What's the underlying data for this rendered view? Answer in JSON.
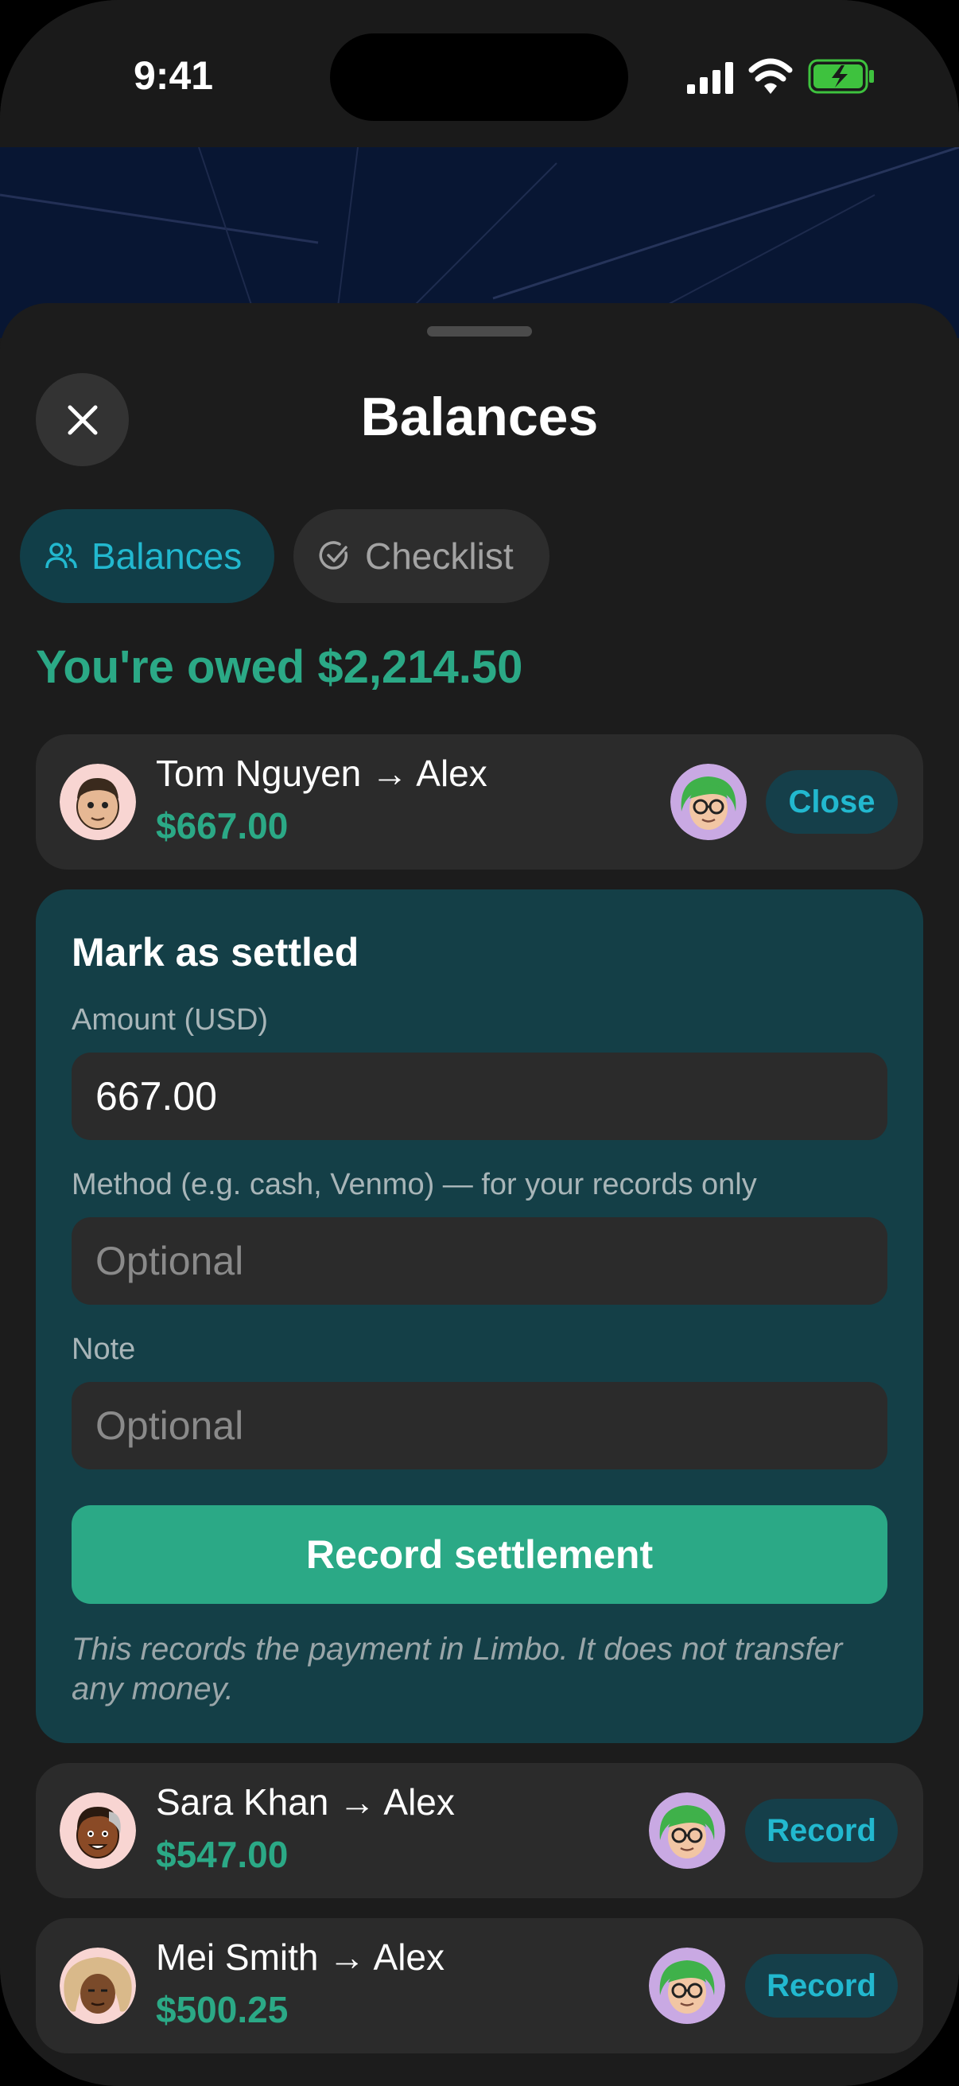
{
  "status": {
    "time": "9:41"
  },
  "sheet": {
    "title": "Balances",
    "tabs": [
      {
        "label": "Balances",
        "active": true,
        "icon": "people-icon"
      },
      {
        "label": "Checklist",
        "active": false,
        "icon": "check-circle-icon"
      }
    ],
    "summary": "You're owed $2,214.50"
  },
  "expanded": {
    "name": "Tom Nguyen → Alex",
    "amount": "$667.00",
    "button": "Close"
  },
  "settle": {
    "title": "Mark as settled",
    "amount_label": "Amount (USD)",
    "amount_value": "667.00",
    "method_label": "Method (e.g. cash, Venmo) — for your records only",
    "method_placeholder": "Optional",
    "note_label": "Note",
    "note_placeholder": "Optional",
    "submit": "Record settlement",
    "disclaimer": "This records the payment in Limbo. It does not transfer any money."
  },
  "rows": [
    {
      "name": "Sara Khan → Alex",
      "amount": "$547.00",
      "button": "Record"
    },
    {
      "name": "Mei Smith → Alex",
      "amount": "$500.25",
      "button": "Record"
    }
  ],
  "colors": {
    "accent_green": "#2ba986",
    "accent_cyan": "#22b8cf",
    "settle_bg": "#143f47"
  }
}
